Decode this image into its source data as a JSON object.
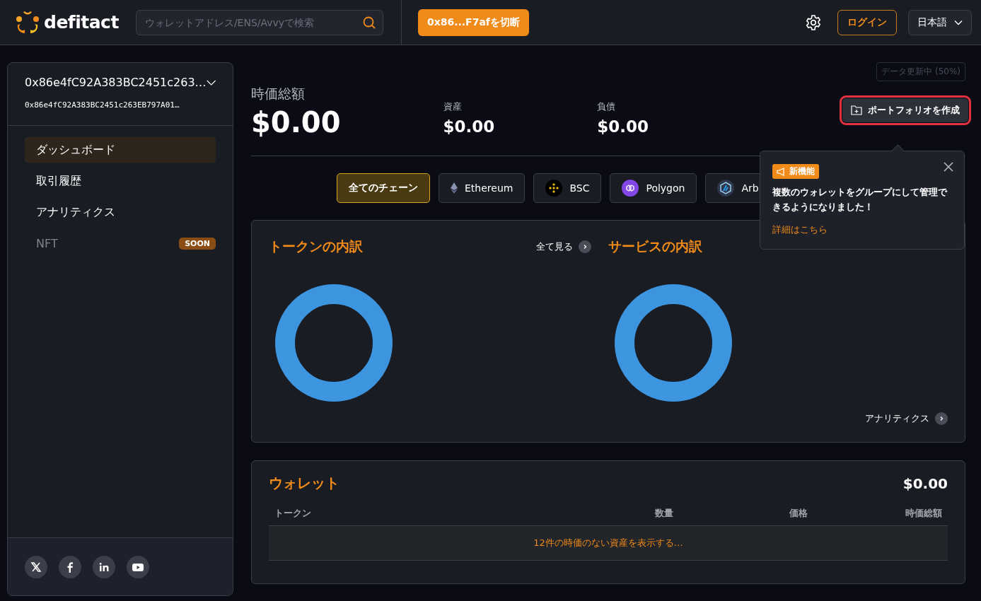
{
  "header": {
    "logo": "defitact",
    "search": {
      "placeholder": "ウォレットアドレス/ENS/Avvyで検索"
    },
    "disconnect_button": "0x86...F7afを切断",
    "login_button": "ログイン",
    "language": "日本語"
  },
  "sidebar": {
    "wallet_name": "0x86e4fC92A383BC2451c263…",
    "wallet_address": "0x86e4fC92A383BC2451c263EB797A01…",
    "items": [
      {
        "label": "ダッシュボード",
        "selected": true,
        "disabled": false
      },
      {
        "label": "取引履歴",
        "selected": false,
        "disabled": false
      },
      {
        "label": "アナリティクス",
        "selected": false,
        "disabled": false
      },
      {
        "label": "NFT",
        "selected": false,
        "disabled": true,
        "badge": "SOON"
      }
    ],
    "social": [
      {
        "kind": "x"
      },
      {
        "kind": "facebook"
      },
      {
        "kind": "linkedin"
      },
      {
        "kind": "youtube"
      }
    ]
  },
  "status_badge": "データ更新中 (50%)",
  "summary": {
    "title": "時価総額",
    "total": "$0.00",
    "assets": {
      "label": "資産",
      "value": "$0.00"
    },
    "liabilities": {
      "label": "負債",
      "value": "$0.00"
    }
  },
  "create_portfolio_button": {
    "label": "ポートフォリオを作成",
    "highlighted": true
  },
  "chains": [
    {
      "kind": "all",
      "label": "全てのチェーン",
      "selected": true
    },
    {
      "kind": "ethereum",
      "label": "Ethereum",
      "selected": false
    },
    {
      "kind": "bsc",
      "label": "BSC",
      "selected": false
    },
    {
      "kind": "polygon",
      "label": "Polygon",
      "selected": false
    },
    {
      "kind": "arbitrum",
      "label": "Arb",
      "selected": false
    }
  ],
  "popover": {
    "badge": "新機能",
    "message": "複数のウォレットをグループにして管理できるようになりました！",
    "link": "詳細はこちら"
  },
  "token_breakdown": {
    "title": "トークンの内訳",
    "link": "全て見る"
  },
  "service_breakdown": {
    "title": "サービスの内訳",
    "link": "アナリティクス"
  },
  "wallet": {
    "title": "ウォレット",
    "total": "$0.00",
    "columns": [
      "トークン",
      "数量",
      "価格",
      "時価総額"
    ],
    "empty_row": "12件の時価のない資産を表示する…"
  }
}
